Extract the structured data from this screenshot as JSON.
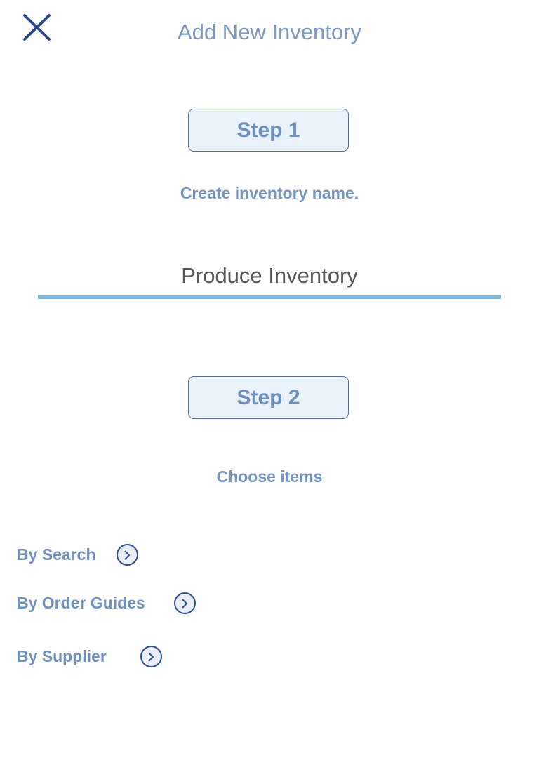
{
  "header": {
    "title": "Add New Inventory",
    "close_icon": "close-x-icon"
  },
  "step1": {
    "label": "Step 1",
    "caption": "Create inventory name.",
    "name_value": "Produce Inventory"
  },
  "step2": {
    "label": "Step 2",
    "caption": "Choose items"
  },
  "options": [
    {
      "label": "By Search",
      "icon": "chevron-right-circle-icon"
    },
    {
      "label": "By Order Guides",
      "icon": "chevron-right-circle-icon"
    },
    {
      "label": "By Supplier",
      "icon": "chevron-right-circle-icon"
    }
  ],
  "colors": {
    "accent": "#2f4d8e",
    "text": "#6f8fbd",
    "underline": "#7cb7e3",
    "step_bg": "#e9f1fb"
  }
}
